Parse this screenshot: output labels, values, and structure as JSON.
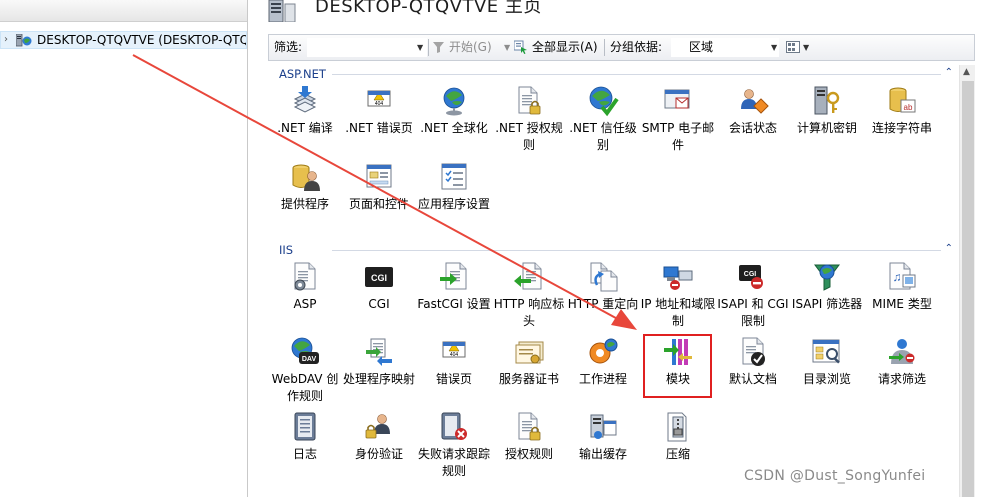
{
  "tree": {
    "server_label": "DESKTOP-QTQVTVE (DESKTOP-QTQVTVE\\",
    "expander": "›"
  },
  "header": {
    "title": "DESKTOP-QTQVTVE 主页"
  },
  "toolbar": {
    "filter_label": "筛选:",
    "go_label": "开始(G)",
    "show_all_label": "全部显示(A)",
    "group_by_label": "分组依据:",
    "group_by_value": "区域"
  },
  "groups": [
    {
      "title": "ASP.NET",
      "toggle": "⌃",
      "features": [
        {
          "label": ".NET 编译",
          "icon": "net-compilation-icon"
        },
        {
          "label": ".NET 错误页",
          "icon": "net-error-pages-icon"
        },
        {
          "label": ".NET 全球化",
          "icon": "net-globalization-icon"
        },
        {
          "label": ".NET 授权规则",
          "icon": "net-authorization-icon"
        },
        {
          "label": ".NET 信任级别",
          "icon": "net-trust-levels-icon"
        },
        {
          "label": "SMTP 电子邮件",
          "icon": "smtp-email-icon"
        },
        {
          "label": "会话状态",
          "icon": "session-state-icon"
        },
        {
          "label": "计算机密钥",
          "icon": "machine-key-icon"
        },
        {
          "label": "连接字符串",
          "icon": "connection-strings-icon"
        },
        {
          "label": "提供程序",
          "icon": "providers-icon"
        },
        {
          "label": "页面和控件",
          "icon": "pages-controls-icon"
        },
        {
          "label": "应用程序设置",
          "icon": "app-settings-icon"
        }
      ]
    },
    {
      "title": "IIS",
      "toggle": "⌃",
      "features": [
        {
          "label": "ASP",
          "icon": "asp-icon"
        },
        {
          "label": "CGI",
          "icon": "cgi-icon"
        },
        {
          "label": "FastCGI 设置",
          "icon": "fastcgi-icon"
        },
        {
          "label": "HTTP 响应标头",
          "icon": "http-response-headers-icon"
        },
        {
          "label": "HTTP 重定向",
          "icon": "http-redirect-icon"
        },
        {
          "label": "IP 地址和域限制",
          "icon": "ip-domain-restrictions-icon"
        },
        {
          "label": "ISAPI 和 CGI 限制",
          "icon": "isapi-cgi-restrictions-icon"
        },
        {
          "label": "ISAPI 筛选器",
          "icon": "isapi-filters-icon"
        },
        {
          "label": "MIME 类型",
          "icon": "mime-types-icon"
        },
        {
          "label": "WebDAV 创作规则",
          "icon": "webdav-icon"
        },
        {
          "label": "处理程序映射",
          "icon": "handler-mappings-icon"
        },
        {
          "label": "错误页",
          "icon": "error-pages-icon"
        },
        {
          "label": "服务器证书",
          "icon": "server-certificates-icon"
        },
        {
          "label": "工作进程",
          "icon": "worker-processes-icon"
        },
        {
          "label": "模块",
          "icon": "modules-icon"
        },
        {
          "label": "默认文档",
          "icon": "default-document-icon"
        },
        {
          "label": "目录浏览",
          "icon": "directory-browsing-icon"
        },
        {
          "label": "请求筛选",
          "icon": "request-filtering-icon"
        },
        {
          "label": "日志",
          "icon": "logging-icon"
        },
        {
          "label": "身份验证",
          "icon": "authentication-icon"
        },
        {
          "label": "失败请求跟踪规则",
          "icon": "failed-request-tracing-icon"
        },
        {
          "label": "授权规则",
          "icon": "authorization-rules-icon"
        },
        {
          "label": "输出缓存",
          "icon": "output-caching-icon"
        },
        {
          "label": "压缩",
          "icon": "compression-icon"
        }
      ]
    }
  ],
  "watermark": "CSDN @Dust_SongYunfei",
  "colors": {
    "highlight": "#e02020",
    "arrow": "#e8473b",
    "group_title": "#1b3f8b"
  }
}
